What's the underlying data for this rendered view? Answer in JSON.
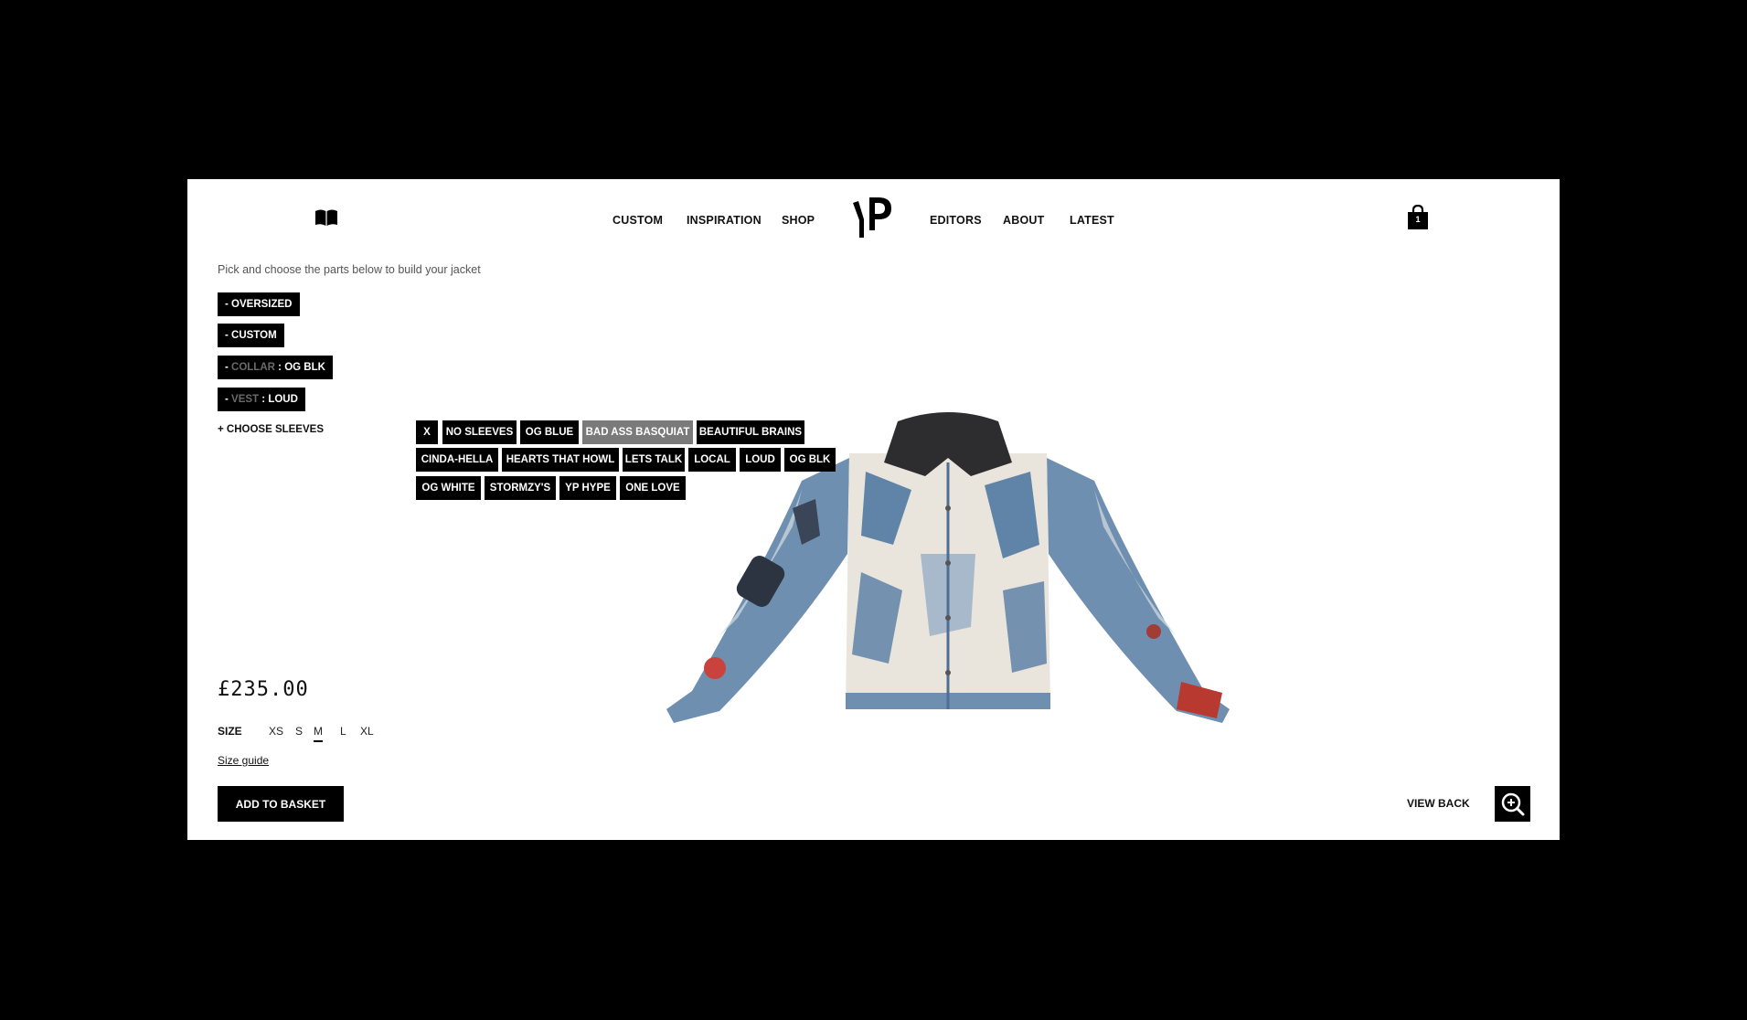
{
  "header": {
    "nav_left": [
      {
        "label": "CUSTOM"
      },
      {
        "label": "INSPIRATION"
      },
      {
        "label": "SHOP"
      }
    ],
    "nav_right": [
      {
        "label": "EDITORS"
      },
      {
        "label": "ABOUT"
      },
      {
        "label": "LATEST"
      }
    ],
    "logo_text": "YP",
    "basket_count": "1",
    "icons": [
      "book-icon",
      "logo",
      "shopping-bag-icon"
    ]
  },
  "builder": {
    "intro": "Pick and choose the parts below to build your jacket",
    "selected_parts": [
      {
        "prefix": "- ",
        "label": "",
        "value": "OVERSIZED"
      },
      {
        "prefix": "- ",
        "label": "",
        "value": "CUSTOM"
      },
      {
        "prefix": "- ",
        "label": "COLLAR",
        "sep": " : ",
        "value": "OG BLK"
      },
      {
        "prefix": "- ",
        "label": "VEST",
        "sep": " : ",
        "value": "LOUD"
      }
    ],
    "choose_sleeves": "+ CHOOSE SLEEVES",
    "sleeve_options": [
      {
        "label": "X"
      },
      {
        "label": "NO SLEEVES"
      },
      {
        "label": "OG BLUE"
      },
      {
        "label": "BAD ASS BASQUIAT",
        "active": true
      },
      {
        "label": "BEAUTIFUL BRAINS"
      },
      {
        "label": "CINDA-HELLA"
      },
      {
        "label": "HEARTS THAT HOWL"
      },
      {
        "label": "LETS TALK"
      },
      {
        "label": "LOCAL"
      },
      {
        "label": "LOUD"
      },
      {
        "label": "OG BLK"
      },
      {
        "label": "OG WHITE"
      },
      {
        "label": "STORMZY'S"
      },
      {
        "label": "YP HYPE"
      },
      {
        "label": "ONE LOVE"
      }
    ]
  },
  "product": {
    "price": "£235.00",
    "size_label": "SIZE",
    "sizes": [
      "XS",
      "S",
      "M",
      "L",
      "XL"
    ],
    "selected_size": "M",
    "size_guide": "Size guide",
    "add_to_basket": "ADD TO BASKET",
    "view_back": "VIEW BACK",
    "zoom_icon": "zoom-in-icon",
    "colors": {
      "frame": "#ffffff",
      "background": "#000000",
      "chip_active": "#7a7a7a",
      "denim": "#5f84a8"
    }
  }
}
